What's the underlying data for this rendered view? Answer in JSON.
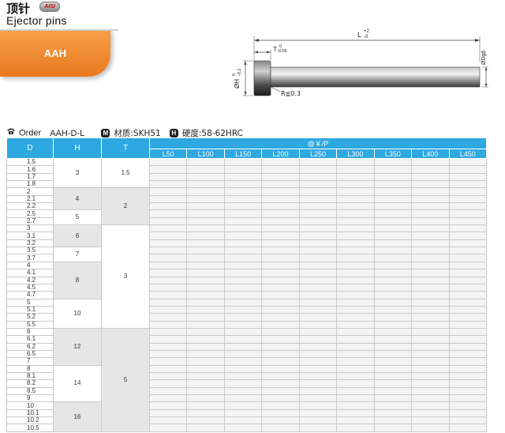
{
  "header": {
    "title_cn": "顶针",
    "badge": "AISI",
    "title_en": "Ejector pins",
    "code": "AAH"
  },
  "drawing": {
    "L_label": "L",
    "L_tol": [
      "+2",
      "-0"
    ],
    "T_label": "T",
    "T_tol": [
      "0",
      "-0.05"
    ],
    "H_label": "ØH",
    "H_tol": [
      "0",
      "-0.2"
    ],
    "D_label": "ØDg6",
    "R_label": "R≦0.3"
  },
  "order": {
    "order_label": "Order",
    "order_code": "AAH-D-L",
    "material_badge": "M",
    "material": "材质:SKH51",
    "hardness_badge": "H",
    "hardness": "硬度:58-62HRC"
  },
  "table": {
    "headers": [
      "D",
      "H",
      "T"
    ],
    "price_header": "@￥/P",
    "lengths": [
      "L50",
      "L100",
      "L150",
      "L200",
      "L250",
      "L300",
      "L350",
      "L400",
      "L450"
    ],
    "d_values": [
      "1.5",
      "1.6",
      "1.7",
      "1.8",
      "2",
      "2.1",
      "2.2",
      "2.5",
      "2.7",
      "3",
      "3.1",
      "3.2",
      "3.5",
      "3.7",
      "4",
      "4.1",
      "4.2",
      "4.5",
      "4.7",
      "5",
      "5.1",
      "5.2",
      "5.5",
      "6",
      "6.1",
      "6.2",
      "6.5",
      "7",
      "8",
      "8.1",
      "8.2",
      "8.5",
      "9",
      "10",
      "10.1",
      "10.2",
      "10.5"
    ],
    "h_groups": [
      {
        "value": "3",
        "rows": 4
      },
      {
        "value": "4",
        "rows": 3
      },
      {
        "value": "5",
        "rows": 2
      },
      {
        "value": "6",
        "rows": 3
      },
      {
        "value": "7",
        "rows": 2
      },
      {
        "value": "8",
        "rows": 5
      },
      {
        "value": "10",
        "rows": 4
      },
      {
        "value": "12",
        "rows": 5
      },
      {
        "value": "14",
        "rows": 5
      },
      {
        "value": "16",
        "rows": 4
      }
    ],
    "t_groups": [
      {
        "value": "1.5",
        "rows": 4
      },
      {
        "value": "2",
        "rows": 5
      },
      {
        "value": "3",
        "rows": 14
      },
      {
        "value": "5",
        "rows": 14
      }
    ]
  }
}
